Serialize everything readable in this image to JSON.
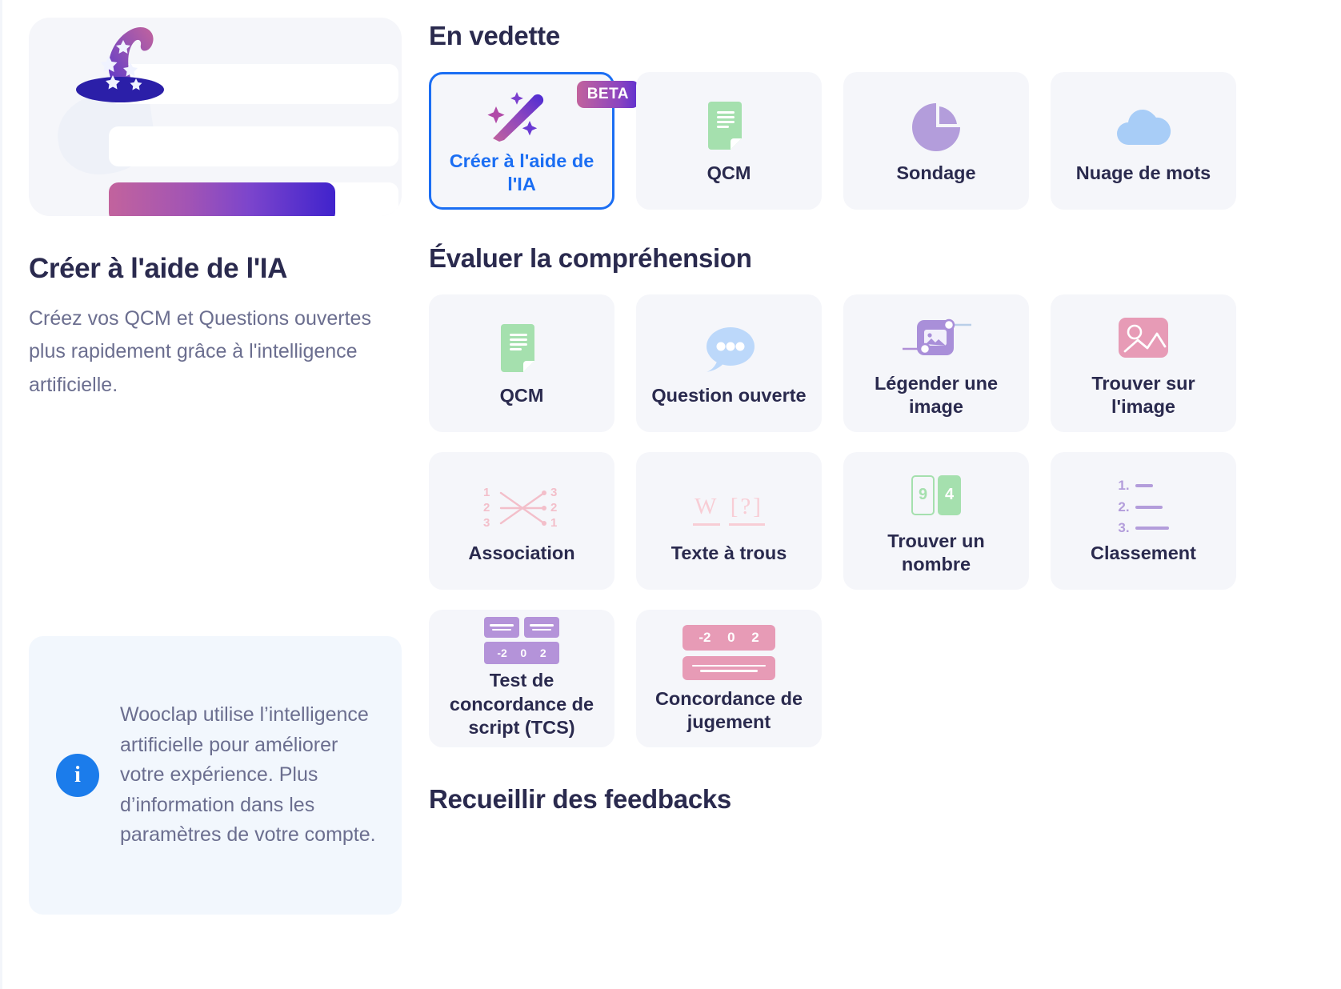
{
  "left": {
    "title": "Créer à l'aide de l'IA",
    "description": "Créez vos QCM et Questions ouvertes plus rapidement grâce à l'intelligence artificielle.",
    "hero_icon": "wizard-hat-icon",
    "info": {
      "icon": "info-circle-icon",
      "icon_glyph": "i",
      "text": "Wooclap utilise l’intelligence artificielle pour améliorer votre expérience. Plus d’information dans les paramètres de votre compte."
    }
  },
  "sections": [
    {
      "title": "En vedette",
      "cards": [
        {
          "label": "Créer à l'aide de l'IA",
          "icon": "magic-wand-icon",
          "badge": "BETA",
          "selected": true
        },
        {
          "label": "QCM",
          "icon": "document-green-icon",
          "selected": false
        },
        {
          "label": "Sondage",
          "icon": "pie-chart-icon",
          "selected": false
        },
        {
          "label": "Nuage de mots",
          "icon": "cloud-icon",
          "selected": false
        }
      ]
    },
    {
      "title": "Évaluer la compréhension",
      "cards": [
        {
          "label": "QCM",
          "icon": "document-green-icon",
          "selected": false
        },
        {
          "label": "Question ouverte",
          "icon": "speech-bubble-icon",
          "selected": false
        },
        {
          "label": "Légender une image",
          "icon": "label-image-icon",
          "selected": false
        },
        {
          "label": "Trouver sur l'image",
          "icon": "find-on-image-icon",
          "selected": false
        },
        {
          "label": "Association",
          "icon": "matching-icon",
          "selected": false
        },
        {
          "label": "Texte à trous",
          "icon": "fill-in-the-blank-icon",
          "selected": false
        },
        {
          "label": "Trouver un nombre",
          "icon": "find-number-icon",
          "selected": false
        },
        {
          "label": "Classement",
          "icon": "ranking-icon",
          "selected": false
        },
        {
          "label": "Test de concordance de script (TCS)",
          "icon": "script-concordance-icon",
          "selected": false
        },
        {
          "label": "Concordance de jugement",
          "icon": "judgment-concordance-icon",
          "selected": false
        }
      ]
    },
    {
      "title": "Recueillir des feedbacks",
      "cards": []
    }
  ],
  "icon_values": {
    "association_left": [
      "1",
      "2",
      "3"
    ],
    "association_right": [
      "3",
      "2",
      "1"
    ],
    "blank_word": "W",
    "blank_placeholder": "[?]",
    "find_number": [
      "9",
      "4"
    ],
    "ranking": [
      "1.",
      "2.",
      "3."
    ],
    "tcs_scale": [
      "-2",
      "0",
      "2"
    ],
    "judgment_scale": [
      "-2",
      "0",
      "2"
    ]
  },
  "colors": {
    "accent_blue": "#1b6ef3",
    "title_navy": "#2a2a4e",
    "body_gray": "#6b6e8f",
    "card_bg": "#f5f6fa",
    "info_bg": "#f2f7fd",
    "info_icon": "#1b7ceb",
    "green": "#a5e0ae",
    "purple": "#b493d9",
    "pink": "#e79bb6",
    "light_blue": "#bcd8fa"
  }
}
